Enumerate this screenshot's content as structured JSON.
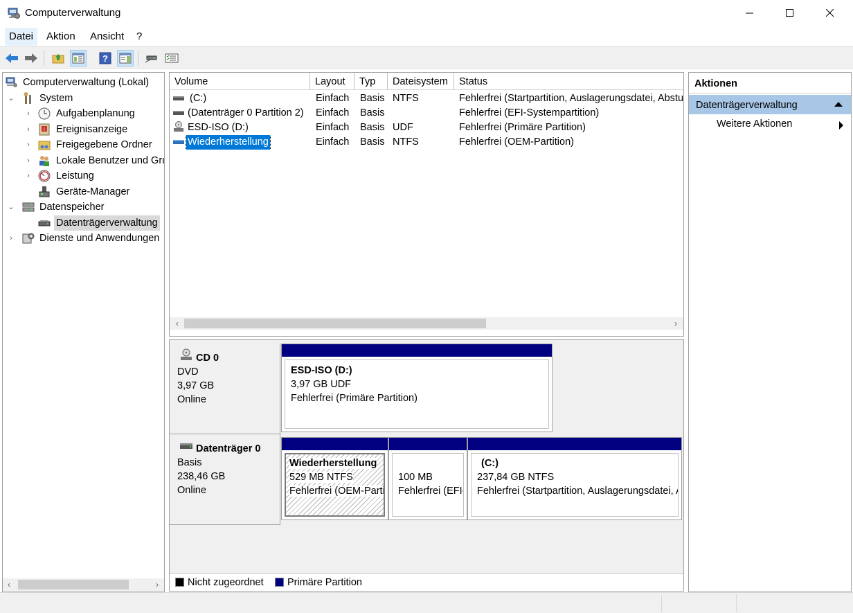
{
  "window": {
    "title": "Computerverwaltung"
  },
  "menu": [
    {
      "label": "Datei"
    },
    {
      "label": "Aktion"
    },
    {
      "label": "Ansicht"
    },
    {
      "label": "?"
    }
  ],
  "tree": {
    "root": "Computerverwaltung (Lokal)",
    "system": "System",
    "aufgabenplanung": "Aufgabenplanung",
    "ereignisanzeige": "Ereignisanzeige",
    "freigegebene": "Freigegebene Ordner",
    "lokale": "Lokale Benutzer und Gruppen",
    "leistung": "Leistung",
    "geraete": "Geräte-Manager",
    "datenspeicher": "Datenspeicher",
    "datentraeger": "Datenträgerverwaltung",
    "dienste": "Dienste und Anwendungen"
  },
  "volumes": {
    "columns": [
      "Volume",
      "Layout",
      "Typ",
      "Dateisystem",
      "Status"
    ],
    "rows": [
      {
        "volume": "(C:)",
        "layout": "Einfach",
        "typ": "Basis",
        "fs": "NTFS",
        "status": "Fehlerfrei (Startpartition, Auslagerungsdatei, Absturzabbild, Primäre Partition)"
      },
      {
        "volume": "(Datenträger 0 Partition 2)",
        "layout": "Einfach",
        "typ": "Basis",
        "fs": "",
        "status": "Fehlerfrei (EFI-Systempartition)"
      },
      {
        "volume": "ESD-ISO (D:)",
        "layout": "Einfach",
        "typ": "Basis",
        "fs": "UDF",
        "status": "Fehlerfrei (Primäre Partition)"
      },
      {
        "volume": "Wiederherstellung",
        "layout": "Einfach",
        "typ": "Basis",
        "fs": "NTFS",
        "status": "Fehlerfrei (OEM-Partition)"
      }
    ]
  },
  "disks": {
    "cd0": {
      "name": "CD 0",
      "type": "DVD",
      "size": "3,97 GB",
      "state": "Online"
    },
    "cd0_part": {
      "title": "ESD-ISO  (D:)",
      "size": "3,97 GB UDF",
      "status": "Fehlerfrei (Primäre Partition)"
    },
    "disk0": {
      "name": "Datenträger 0",
      "type": "Basis",
      "size": "238,46 GB",
      "state": "Online"
    },
    "disk0_p1": {
      "title": "Wiederherstellung",
      "size": "529 MB NTFS",
      "status": "Fehlerfrei (OEM-Partition)"
    },
    "disk0_p2": {
      "size": "100 MB",
      "status": "Fehlerfrei (EFI-Systempartition)"
    },
    "disk0_p3": {
      "title": "(C:)",
      "size": "237,84 GB NTFS",
      "status": "Fehlerfrei (Startpartition, Auslagerungsdatei, Absturzabbild, Primäre Partition)"
    }
  },
  "legend": [
    {
      "label": "Nicht zugeordnet",
      "color": "#000000"
    },
    {
      "label": "Primäre Partition",
      "color": "#000080"
    }
  ],
  "actions": {
    "header": "Aktionen",
    "section": "Datenträgerverwaltung",
    "more": "Weitere Aktionen"
  },
  "colors": {
    "partition_bar": "#000080",
    "action_section": "#a8c6e6",
    "selection": "#0078d7"
  }
}
